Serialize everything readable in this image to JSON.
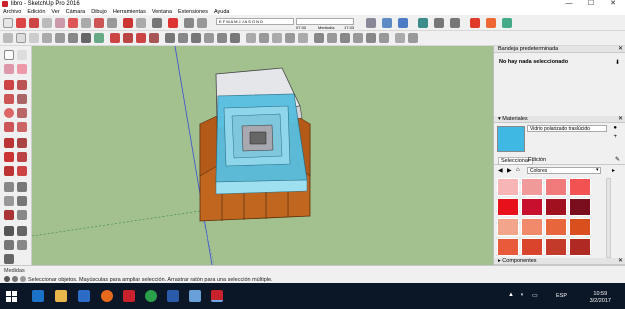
{
  "window": {
    "title": "libro - SketchUp Pro 2016",
    "minimize": "—",
    "maximize": "☐",
    "close": "✕"
  },
  "menu": [
    "Archivo",
    "Edición",
    "Ver",
    "Cámara",
    "Dibujo",
    "Herramientas",
    "Ventana",
    "Extensiones",
    "Ayuda"
  ],
  "shadow_bar": {
    "months": "E F M A M J J A S O N D",
    "time_start": "07:30",
    "time_mid": "Mediodía",
    "time_end": "17:33"
  },
  "tray": {
    "title": "Bandeja predeterminada",
    "entity_info": "No hay nada seleccionado"
  },
  "materials": {
    "section_title": "Materiales",
    "current_name": "Vidrio polarizado traslúcido",
    "current_color": "#3fb9e4",
    "tab_select": "Seleccionar",
    "tab_edit": "Edición",
    "library": "Colores",
    "swatches": [
      "#f7b5b5",
      "#f09a9a",
      "#f17a7a",
      "#f25252",
      "#e8101a",
      "#c8102e",
      "#a0101e",
      "#7a0d1e",
      "#f2a58a",
      "#f08a6a",
      "#e8663c",
      "#d94f1e",
      "#e85a3a",
      "#d8442c",
      "#c43a2a",
      "#b02a24"
    ]
  },
  "components_title": "Componentes",
  "status": {
    "measures_label": "Medidas",
    "hint": "Seleccionar objetos. Mayúsculas para ampliar selección. Arrastrar ratón para una selección múltiple."
  },
  "taskbar": {
    "lang": "ESP",
    "time": "10:59",
    "date": "3/2/2017"
  }
}
